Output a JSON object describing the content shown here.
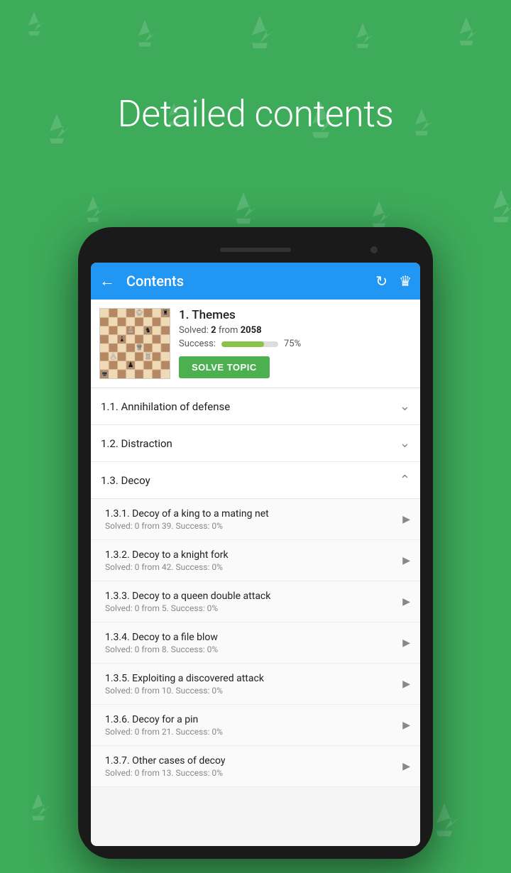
{
  "page": {
    "title": "Detailed contents",
    "background_color": "#3dab5a"
  },
  "appbar": {
    "title": "Contents",
    "back_label": "←"
  },
  "topic": {
    "title": "1. Themes",
    "solved_label": "Solved:",
    "solved_count": "2",
    "solved_from": "from",
    "solved_total": "2058",
    "success_label": "Success:",
    "success_pct": "75%",
    "progress_pct": 75,
    "solve_btn": "SOLVE TOPIC"
  },
  "sections": [
    {
      "label": "1.1. Annihilation of defense",
      "expanded": false,
      "children": []
    },
    {
      "label": "1.2. Distraction",
      "expanded": false,
      "children": []
    },
    {
      "label": "1.3. Decoy",
      "expanded": true,
      "children": [
        {
          "title": "1.3.1. Decoy of a king to a mating net",
          "meta": "Solved: 0 from 39. Success: 0%"
        },
        {
          "title": "1.3.2. Decoy to a knight fork",
          "meta": "Solved: 0 from 42. Success: 0%"
        },
        {
          "title": "1.3.3. Decoy to a queen double attack",
          "meta": "Solved: 0 from 5. Success: 0%"
        },
        {
          "title": "1.3.4. Decoy to a file blow",
          "meta": "Solved: 0 from 8. Success: 0%"
        },
        {
          "title": "1.3.5. Exploiting a discovered attack",
          "meta": "Solved: 0 from 10. Success: 0%"
        },
        {
          "title": "1.3.6. Decoy for a pin",
          "meta": "Solved: 0 from 21. Success: 0%"
        },
        {
          "title": "1.3.7. Other cases of decoy",
          "meta": "Solved: 0 from 13. Success: 0%"
        }
      ]
    }
  ]
}
